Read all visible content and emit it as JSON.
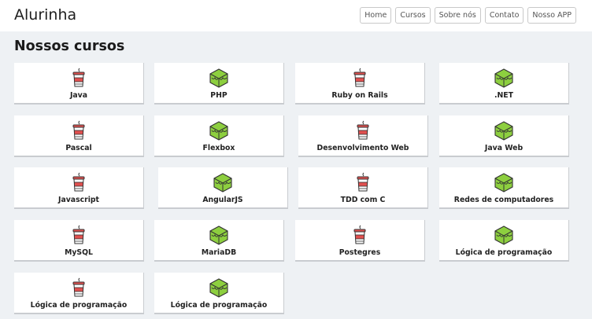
{
  "brand": "Alurinha",
  "nav": [
    "Home",
    "Cursos",
    "Sobre nós",
    "Contato",
    "Nosso APP"
  ],
  "section_title": "Nossos cursos",
  "icons": {
    "cup": "red-cup-icon",
    "cube": "green-cube-icon"
  },
  "colors": {
    "cup": "#e0504f",
    "cube": "#8dcf3f"
  },
  "courses": [
    {
      "label": "Java",
      "icon": "cup"
    },
    {
      "label": "PHP",
      "icon": "cube"
    },
    {
      "label": "Ruby on Rails",
      "icon": "cup"
    },
    {
      "label": ".NET",
      "icon": "cube"
    },
    {
      "label": "Pascal",
      "icon": "cup"
    },
    {
      "label": "Flexbox",
      "icon": "cube"
    },
    {
      "label": "Desenvolvimento Web",
      "icon": "cup"
    },
    {
      "label": "Java Web",
      "icon": "cube"
    },
    {
      "label": "Javascript",
      "icon": "cup"
    },
    {
      "label": "AngularJS",
      "icon": "cube"
    },
    {
      "label": "TDD com C",
      "icon": "cup"
    },
    {
      "label": "Redes de computadores",
      "icon": "cube"
    },
    {
      "label": "MySQL",
      "icon": "cup"
    },
    {
      "label": "MariaDB",
      "icon": "cube"
    },
    {
      "label": "Postegres",
      "icon": "cup"
    },
    {
      "label": "Lógica de programação",
      "icon": "cube"
    },
    {
      "label": "Lógica de programação",
      "icon": "cup"
    },
    {
      "label": "Lógica de programação",
      "icon": "cube"
    }
  ]
}
